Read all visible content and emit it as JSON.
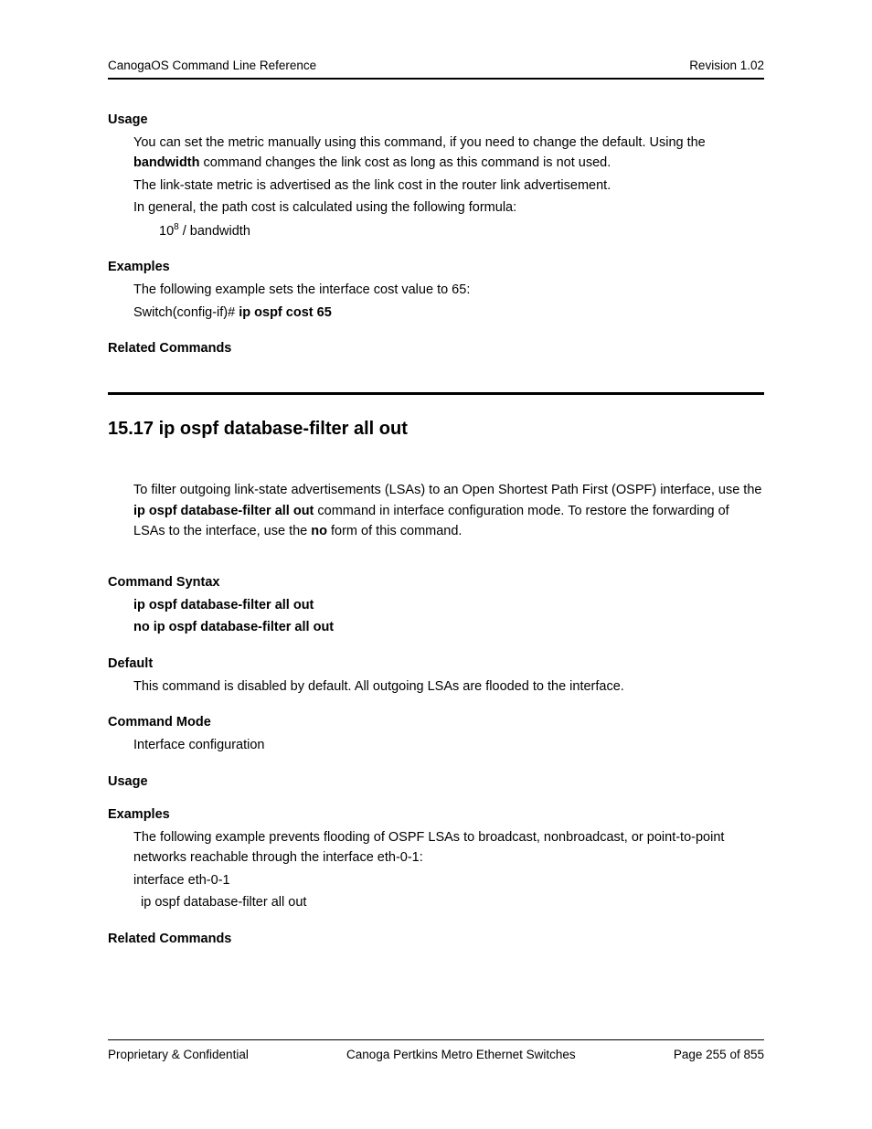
{
  "header": {
    "left": "CanogaOS Command Line Reference",
    "right": "Revision 1.02"
  },
  "s1": {
    "usage": {
      "heading": "Usage",
      "p1a": "You can set the metric manually using this command, if you need to change the default. Using the ",
      "p1b": "bandwidth",
      "p1c": " command changes the link cost as long as this command is not used.",
      "p2": "The link-state metric is advertised as the link cost in the router link advertisement.",
      "p3": "In general, the path cost is calculated using the following formula:",
      "formula_base": "10",
      "formula_sup": "8",
      "formula_rest": " / bandwidth"
    },
    "examples": {
      "heading": "Examples",
      "p1": "The following example sets the interface cost value to 65:",
      "p2a": "Switch(config-if)# ",
      "p2b": "ip ospf cost 65"
    },
    "related": {
      "heading": "Related Commands"
    }
  },
  "s2": {
    "title": "15.17  ip ospf database-filter all out",
    "intro": {
      "t1": "To filter outgoing link-state advertisements (LSAs) to an Open Shortest Path First (OSPF) interface, use the ",
      "b1": "ip ospf database-filter all out",
      "t2": " command in interface configuration mode. To restore the forwarding of LSAs to the interface, use the ",
      "b2": "no",
      "t3": " form of this command."
    },
    "syntax": {
      "heading": "Command Syntax",
      "l1": "ip ospf database-filter all out",
      "l2": "no ip ospf database-filter all out"
    },
    "default": {
      "heading": "Default",
      "p1": "This command is disabled by default. All outgoing LSAs are flooded to the interface."
    },
    "mode": {
      "heading": "Command Mode",
      "p1": "Interface configuration"
    },
    "usage": {
      "heading": "Usage"
    },
    "examples": {
      "heading": "Examples",
      "p1": "The following example prevents flooding of OSPF LSAs to broadcast, nonbroadcast, or point-to-point networks reachable through the interface eth-0-1:",
      "p2": "interface eth-0-1",
      "p3": "  ip ospf database-filter all out"
    },
    "related": {
      "heading": "Related Commands"
    }
  },
  "footer": {
    "left": "Proprietary & Confidential",
    "center": "Canoga Pertkins Metro Ethernet Switches",
    "right": "Page 255 of 855"
  }
}
